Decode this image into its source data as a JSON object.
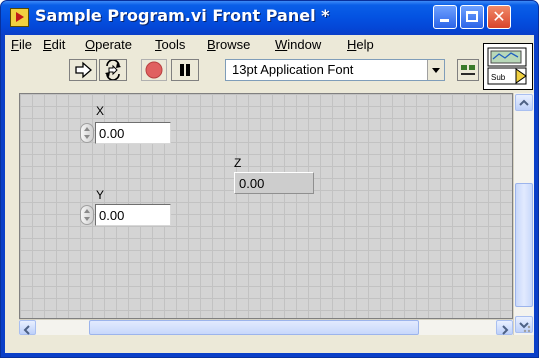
{
  "window": {
    "title": "Sample Program.vi Front Panel *",
    "buttons": {
      "minimize": "minimize",
      "maximize": "maximize",
      "close": "✕"
    }
  },
  "menu": [
    {
      "label": "File",
      "mnemonic": "F",
      "rest": "ile"
    },
    {
      "label": "Edit",
      "mnemonic": "E",
      "rest": "dit"
    },
    {
      "label": "Operate",
      "mnemonic": "O",
      "rest": "perate"
    },
    {
      "label": "Tools",
      "mnemonic": "T",
      "rest": "ools"
    },
    {
      "label": "Browse",
      "mnemonic": "B",
      "rest": "rowse"
    },
    {
      "label": "Window",
      "mnemonic": "W",
      "rest": "indow"
    },
    {
      "label": "Help",
      "mnemonic": "H",
      "rest": "elp"
    }
  ],
  "toolbar": {
    "tools": [
      "run-arrow-icon",
      "run-continuously-icon",
      "abort-icon",
      "pause-icon"
    ],
    "font_select": "13pt Application Font",
    "align_tool": "align-objects-icon"
  },
  "vi_icon": {
    "label": "Sub",
    "icon": "vi-connector-icon"
  },
  "panel": {
    "controls": [
      {
        "label": "X",
        "value": "0.00",
        "kind": "numeric-control"
      },
      {
        "label": "Y",
        "value": "0.00",
        "kind": "numeric-control"
      }
    ],
    "indicators": [
      {
        "label": "Z",
        "value": "0.00",
        "kind": "numeric-indicator"
      }
    ]
  },
  "colors": {
    "title_bar": "#0453e2",
    "close_button": "#d9442a",
    "panel_grid": "#d4d4d4",
    "abort_red": "#e06060"
  }
}
